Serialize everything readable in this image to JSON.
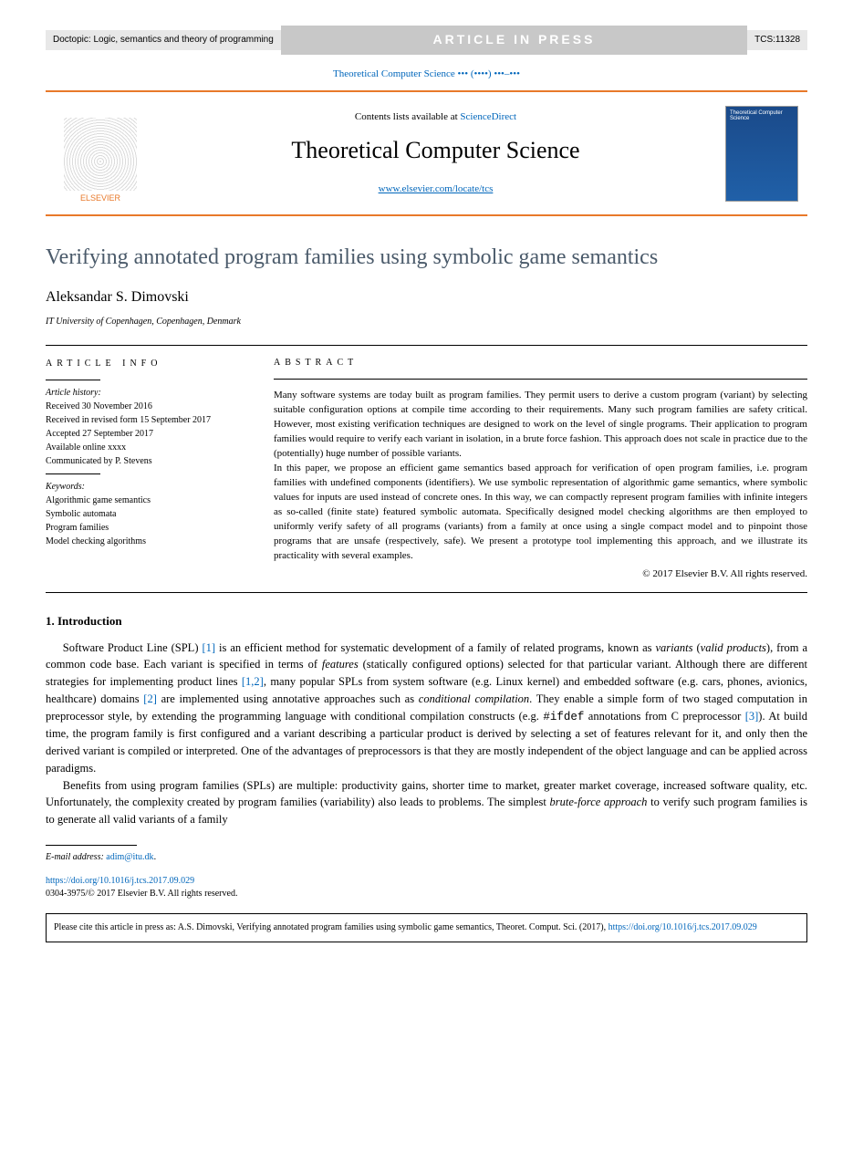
{
  "topbar": {
    "doctopic": "Doctopic: Logic, semantics and theory of programming",
    "aip": "ARTICLE IN PRESS",
    "tcsid": "TCS:11328"
  },
  "header": {
    "journal_ref": "Theoretical Computer Science ••• (••••) •••–•••",
    "contents_prefix": "Contents lists available at ",
    "contents_link": "ScienceDirect",
    "journal_title": "Theoretical Computer Science",
    "journal_link": "www.elsevier.com/locate/tcs",
    "publisher": "ELSEVIER",
    "cover_label": "Theoretical Computer Science"
  },
  "article": {
    "title": "Verifying annotated program families using symbolic game semantics",
    "author": "Aleksandar S. Dimovski",
    "affiliation": "IT University of Copenhagen, Copenhagen, Denmark"
  },
  "info": {
    "heading": "article info",
    "history_label": "Article history:",
    "received": "Received 30 November 2016",
    "revised": "Received in revised form 15 September 2017",
    "accepted": "Accepted 27 September 2017",
    "online": "Available online xxxx",
    "communicated": "Communicated by P. Stevens",
    "keywords_label": "Keywords:",
    "kw1": "Algorithmic game semantics",
    "kw2": "Symbolic automata",
    "kw3": "Program families",
    "kw4": "Model checking algorithms"
  },
  "abstract": {
    "heading": "abstract",
    "p1": "Many software systems are today built as program families. They permit users to derive a custom program (variant) by selecting suitable configuration options at compile time according to their requirements. Many such program families are safety critical. However, most existing verification techniques are designed to work on the level of single programs. Their application to program families would require to verify each variant in isolation, in a brute force fashion. This approach does not scale in practice due to the (potentially) huge number of possible variants.",
    "p2": "In this paper, we propose an efficient game semantics based approach for verification of open program families, i.e. program families with undefined components (identifiers). We use symbolic representation of algorithmic game semantics, where symbolic values for inputs are used instead of concrete ones. In this way, we can compactly represent program families with infinite integers as so-called (finite state) featured symbolic automata. Specifically designed model checking algorithms are then employed to uniformly verify safety of all programs (variants) from a family at once using a single compact model and to pinpoint those programs that are unsafe (respectively, safe). We present a prototype tool implementing this approach, and we illustrate its practicality with several examples.",
    "copyright": "© 2017 Elsevier B.V. All rights reserved."
  },
  "body": {
    "sec1_heading": "1. Introduction",
    "p1_a": "Software Product Line (SPL) ",
    "ref1": "[1]",
    "p1_b": " is an efficient method for systematic development of a family of related programs, known as ",
    "p1_c": "variants",
    "p1_d": " (",
    "p1_e": "valid products",
    "p1_f": "), from a common code base. Each variant is specified in terms of ",
    "p1_g": "features",
    "p1_h": " (statically configured options) selected for that particular variant. Although there are different strategies for implementing product lines ",
    "ref12": "[1,2]",
    "p1_i": ", many popular SPLs from system software (e.g. Linux kernel) and embedded software (e.g. cars, phones, avionics, healthcare) domains ",
    "ref2": "[2]",
    "p1_j": " are implemented using annotative approaches such as ",
    "p1_k": "conditional compilation",
    "p1_l": ". They enable a simple form of two staged computation in preprocessor style, by extending the programming language with conditional compilation constructs (e.g. ",
    "p1_m": "#ifdef",
    "p1_n": " annotations from C preprocessor ",
    "ref3": "[3]",
    "p1_o": "). At build time, the program family is first configured and a variant describing a particular product is derived by selecting a set of features relevant for it, and only then the derived variant is compiled or interpreted. One of the advantages of preprocessors is that they are mostly independent of the object language and can be applied across paradigms.",
    "p2_a": "Benefits from using program families (SPLs) are multiple: productivity gains, shorter time to market, greater market coverage, increased software quality, etc. Unfortunately, the complexity created by program families (variability) also leads to problems. The simplest ",
    "p2_b": "brute-force approach",
    "p2_c": " to verify such program families is to generate all valid variants of a family"
  },
  "footer": {
    "email_label": "E-mail address:",
    "email": "adim@itu.dk",
    "doi": "https://doi.org/10.1016/j.tcs.2017.09.029",
    "copyright_line": "0304-3975/© 2017 Elsevier B.V. All rights reserved.",
    "cite_text": "Please cite this article in press as: A.S. Dimovski, Verifying annotated program families using symbolic game semantics, Theoret. Comput. Sci. (2017), ",
    "cite_doi": "https://doi.org/10.1016/j.tcs.2017.09.029"
  }
}
